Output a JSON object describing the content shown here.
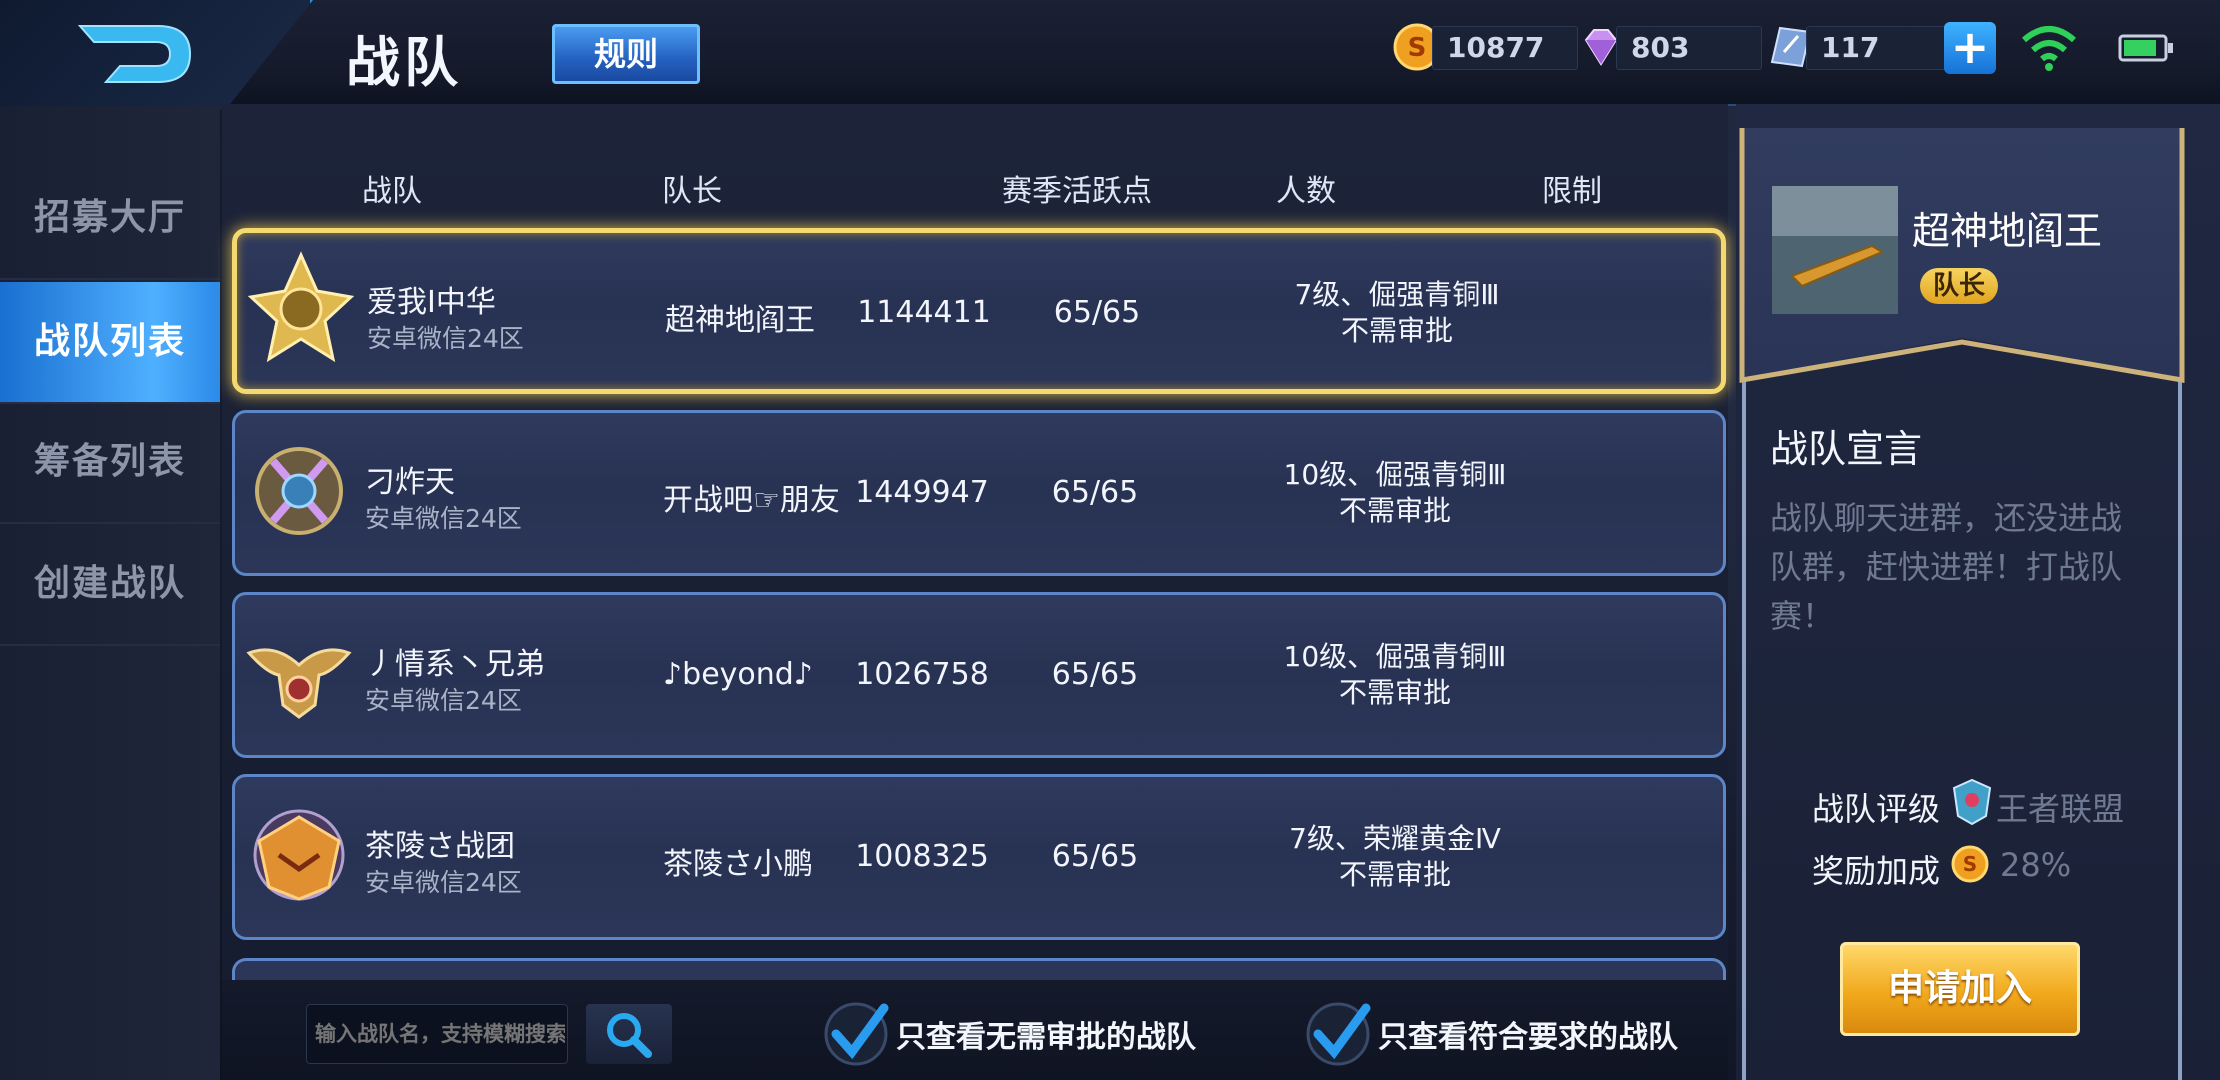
{
  "header": {
    "title": "战队",
    "rules_label": "规则",
    "resources": [
      {
        "icon": "gold-coin-icon",
        "value": "10877"
      },
      {
        "icon": "diamond-icon",
        "value": "803"
      },
      {
        "icon": "voucher-icon",
        "value": "117"
      }
    ]
  },
  "sidebar": {
    "items": [
      {
        "label": "招募大厅",
        "active": false
      },
      {
        "label": "战队列表",
        "active": true
      },
      {
        "label": "筹备列表",
        "active": false
      },
      {
        "label": "创建战队",
        "active": false
      }
    ]
  },
  "table": {
    "columns": [
      "战队",
      "队长",
      "赛季活跃点",
      "人数",
      "限制"
    ],
    "rows": [
      {
        "name": "爱我I中华",
        "server": "安卓微信24区",
        "captain": "超神地阎王",
        "points": "1144411",
        "members": "65/65",
        "limit": "7级、倔强青铜Ⅲ",
        "approval": "不需审批",
        "selected": true
      },
      {
        "name": "刁炸天",
        "server": "安卓微信24区",
        "captain": "开战吧☞朋友",
        "points": "1449947",
        "members": "65/65",
        "limit": "10级、倔强青铜Ⅲ",
        "approval": "不需审批",
        "selected": false
      },
      {
        "name": "丿情系丶兄弟",
        "server": "安卓微信24区",
        "captain": "♪beyond♪",
        "points": "1026758",
        "members": "65/65",
        "limit": "10级、倔强青铜Ⅲ",
        "approval": "不需审批",
        "selected": false
      },
      {
        "name": "茶陵さ战团",
        "server": "安卓微信24区",
        "captain": "茶陵さ小鹏",
        "points": "1008325",
        "members": "65/65",
        "limit": "7级、荣耀黄金Ⅳ",
        "approval": "不需审批",
        "selected": false
      }
    ]
  },
  "bottom": {
    "search_placeholder": "输入战队名，支持模糊搜索",
    "filter_no_approval": "只查看无需审批的战队",
    "filter_eligible": "只查看符合要求的战队"
  },
  "detail": {
    "captain_name": "超神地阎王",
    "badge": "队长",
    "manifesto_title": "战队宣言",
    "manifesto_text": "战队聊天进群，还没进战队群，赶快进群！打战队赛！",
    "rating_label": "战队评级",
    "rating_value": "王者联盟",
    "bonus_label": "奖励加成",
    "bonus_value": "28%",
    "apply_label": "申请加入"
  }
}
